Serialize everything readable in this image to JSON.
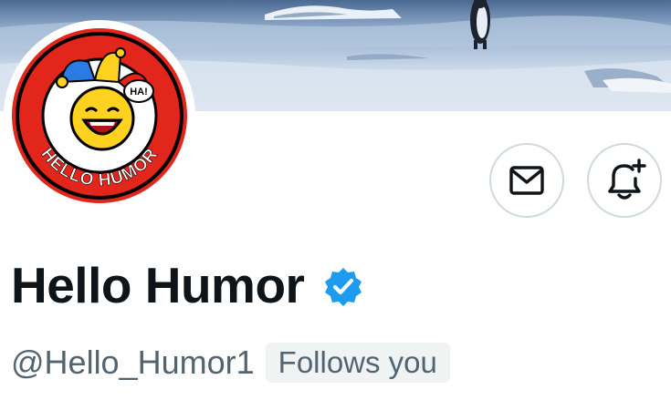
{
  "profile": {
    "display_name": "Hello Humor",
    "handle": "@Hello_Humor1",
    "follows_you_label": "Follows you",
    "verified": true
  },
  "avatar": {
    "speech_bubble_text": "HA!",
    "ring_text": "HELLO HUMOR"
  },
  "actions": {
    "message_icon": "envelope-icon",
    "notify_icon": "bell-plus-icon"
  },
  "colors": {
    "verified_blue": "#1d9bf0",
    "text_primary": "#0f1419",
    "text_secondary": "#536471",
    "badge_bg": "#eff3f4",
    "avatar_red": "#e3261c",
    "avatar_yellow": "#ffd21f"
  }
}
